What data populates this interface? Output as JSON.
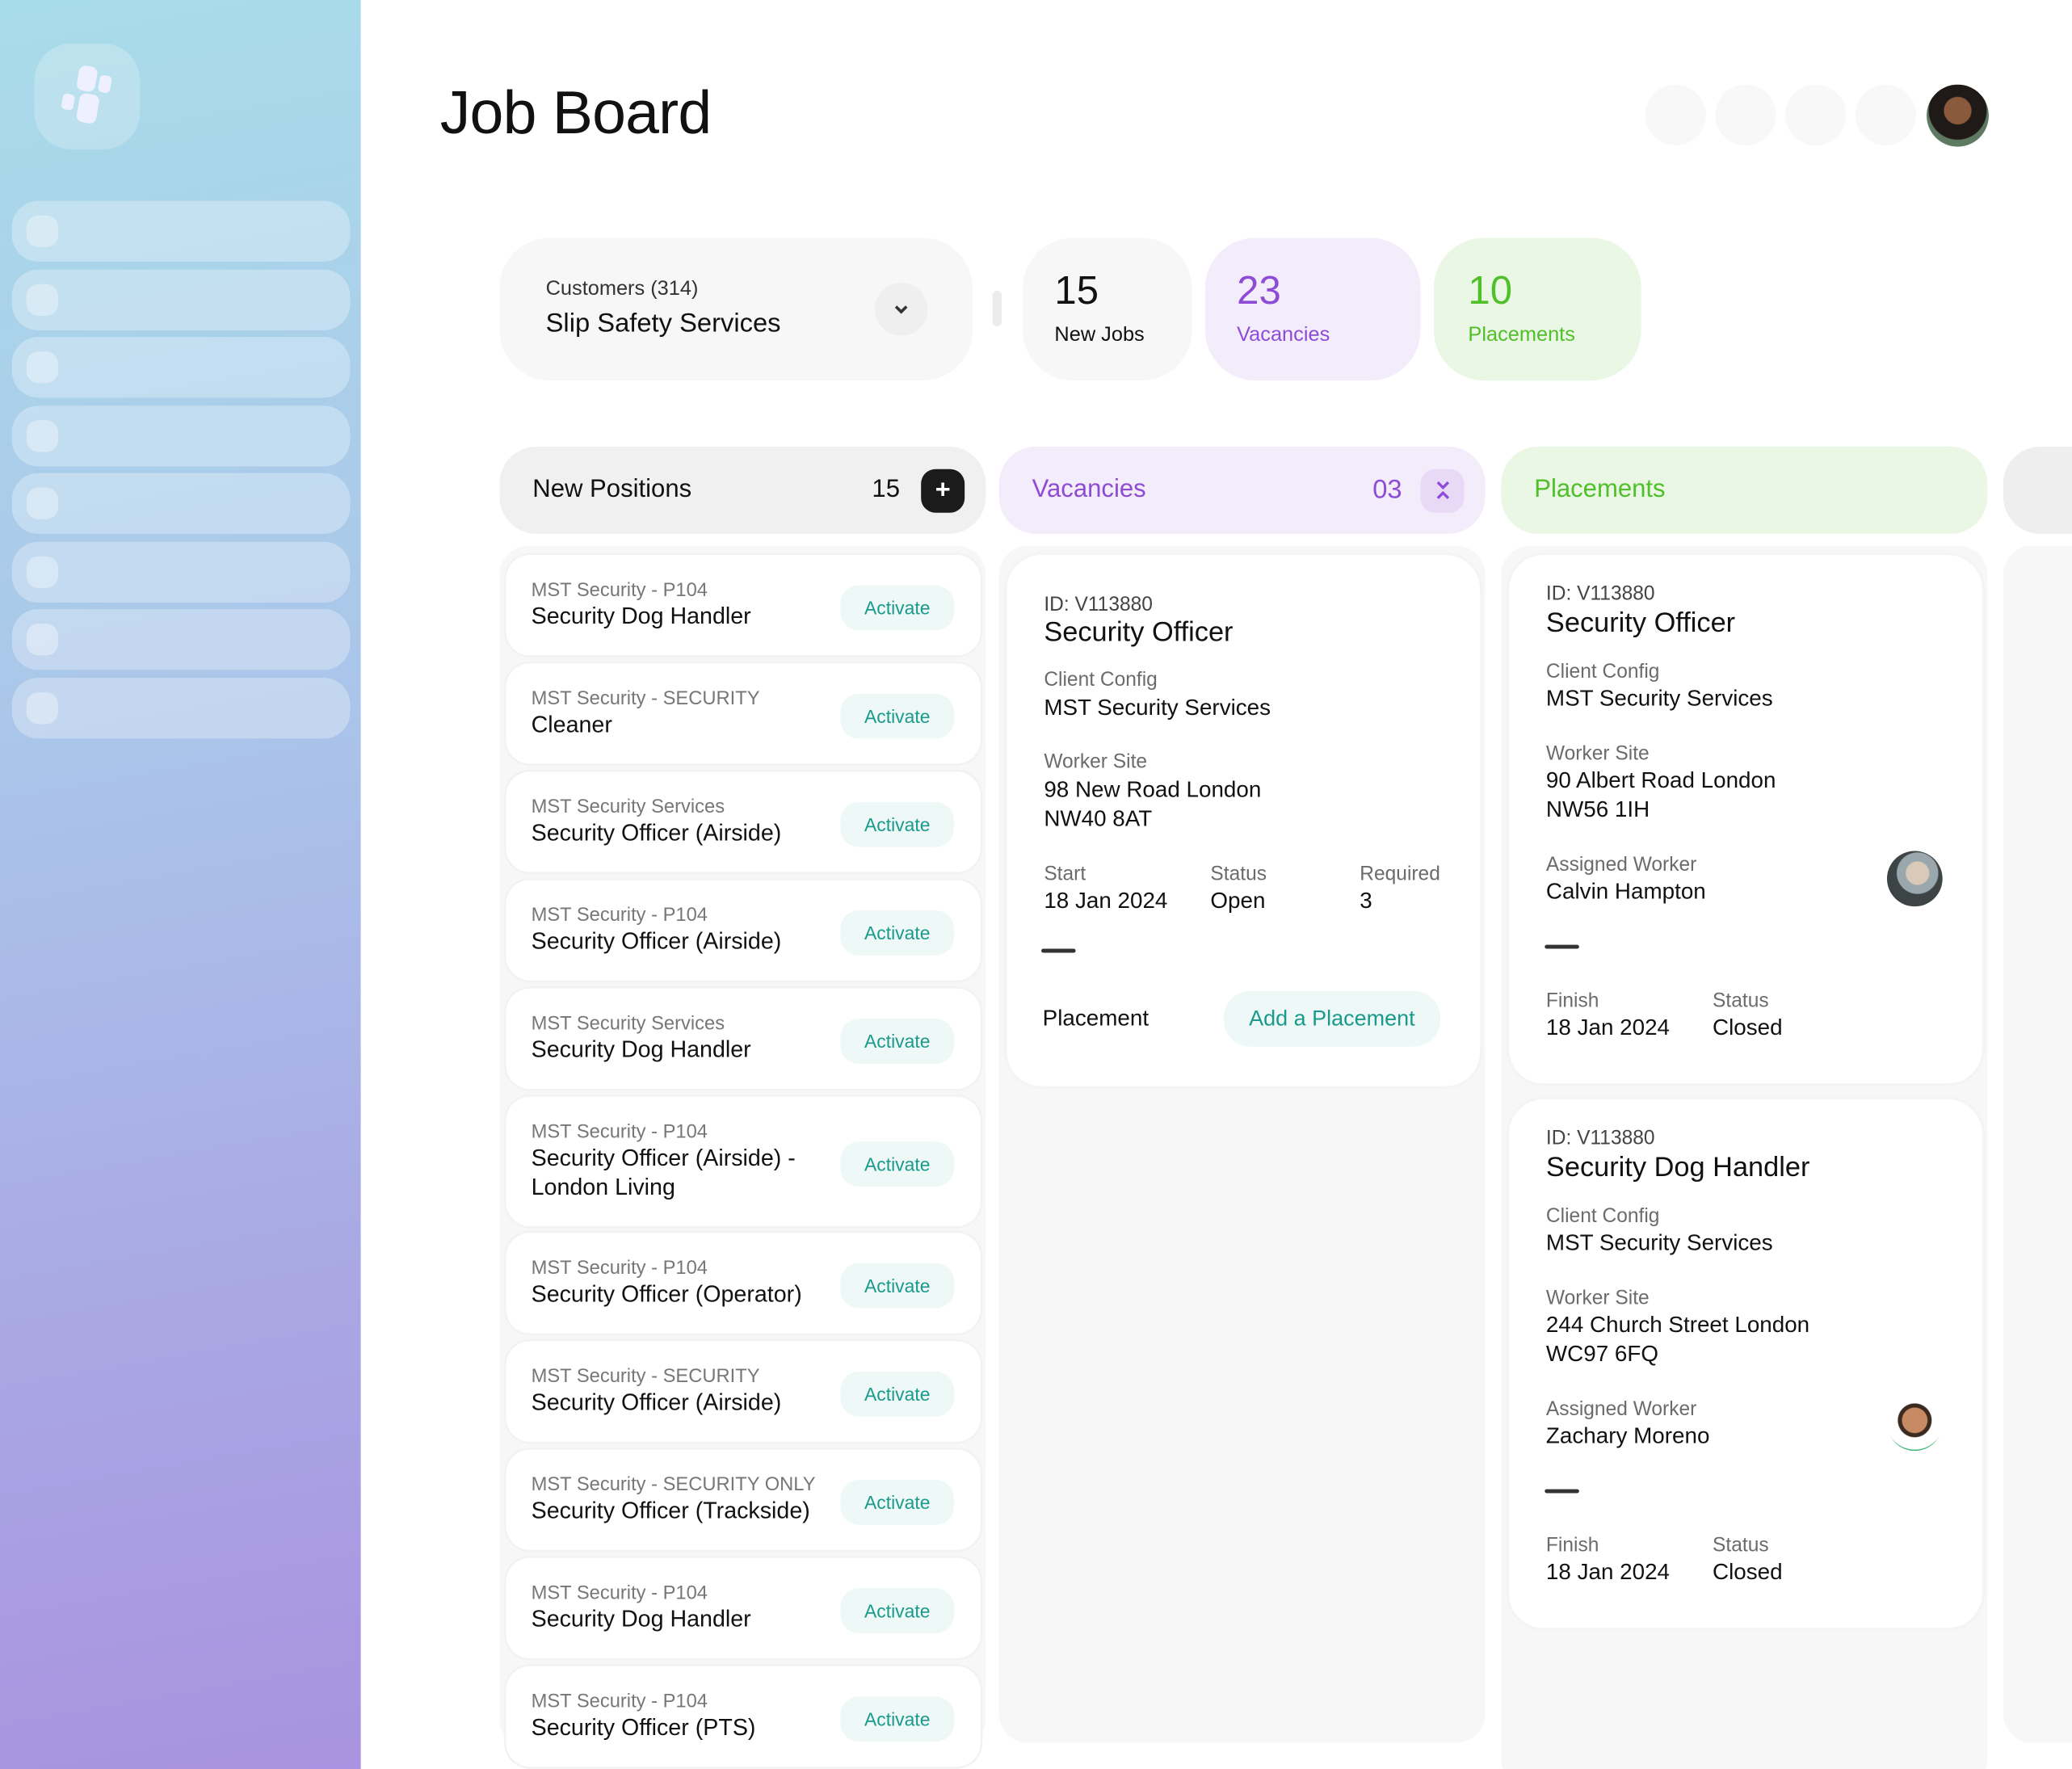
{
  "page": {
    "title": "Job Board"
  },
  "colors": {
    "purple": "#8e4bd6",
    "green": "#4fbf2a",
    "teal": "#1a9a8c"
  },
  "customer": {
    "label": "Customers (314)",
    "value": "Slip Safety Services",
    "icon": "chevron-down-icon"
  },
  "stats": [
    {
      "value": "15",
      "label": "New Jobs"
    },
    {
      "value": "23",
      "label": "Vacancies"
    },
    {
      "value": "10",
      "label": "Placements"
    }
  ],
  "columns": {
    "new_positions": {
      "title": "New Positions",
      "count": "15",
      "icon": "plus-icon"
    },
    "vacancies": {
      "title": "Vacancies",
      "count": "03",
      "icon": "collapse-icon"
    },
    "placements": {
      "title": "Placements"
    }
  },
  "positions": [
    {
      "company": "MST Security - P104",
      "title": "Security Dog Handler",
      "action": "Activate"
    },
    {
      "company": "MST Security - SECURITY",
      "title": "Cleaner",
      "action": "Activate"
    },
    {
      "company": "MST Security Services",
      "title": "Security Officer (Airside)",
      "action": "Activate"
    },
    {
      "company": "MST Security - P104",
      "title": "Security Officer (Airside)",
      "action": "Activate"
    },
    {
      "company": "MST Security Services",
      "title": "Security Dog Handler",
      "action": "Activate"
    },
    {
      "company": "MST Security - P104",
      "title": "Security Officer (Airside) - London Living",
      "action": "Activate"
    },
    {
      "company": "MST Security - P104",
      "title": "Security Officer (Operator)",
      "action": "Activate"
    },
    {
      "company": "MST Security - SECURITY",
      "title": "Security Officer (Airside)",
      "action": "Activate"
    },
    {
      "company": "MST Security - SECURITY ONLY",
      "title": "Security Officer (Trackside)",
      "action": "Activate"
    },
    {
      "company": "MST Security - P104",
      "title": "Security Dog Handler",
      "action": "Activate"
    },
    {
      "company": "MST Security - P104",
      "title": "Security Officer (PTS)",
      "action": "Activate"
    }
  ],
  "vacancy": {
    "id": "ID: V113880",
    "title": "Security Officer",
    "client_label": "Client Config",
    "client": "MST Security Services",
    "site_label": "Worker Site",
    "site_line1": "98 New Road London",
    "site_line2": "NW40 8AT",
    "start_label": "Start",
    "start": "18 Jan 2024",
    "status_label": "Status",
    "status": "Open",
    "required_label": "Required",
    "required": "3",
    "placement_label": "Placement",
    "add_button": "Add a Placement"
  },
  "placements": [
    {
      "id": "ID: V113880",
      "title": "Security Officer",
      "client_label": "Client Config",
      "client": "MST Security Services",
      "site_label": "Worker Site",
      "site_line1": "90 Albert Road London",
      "site_line2": "NW56 1IH",
      "worker_label": "Assigned Worker",
      "worker": "Calvin Hampton",
      "finish_label": "Finish",
      "finish": "18 Jan 2024",
      "status_label": "Status",
      "status": "Closed"
    },
    {
      "id": "ID: V113880",
      "title": "Security Dog Handler",
      "client_label": "Client Config",
      "client": "MST Security Services",
      "site_label": "Worker Site",
      "site_line1": "244 Church Street London",
      "site_line2": "WC97 6FQ",
      "worker_label": "Assigned Worker",
      "worker": "Zachary Moreno",
      "finish_label": "Finish",
      "finish": "18 Jan 2024",
      "status_label": "Status",
      "status": "Closed"
    }
  ]
}
